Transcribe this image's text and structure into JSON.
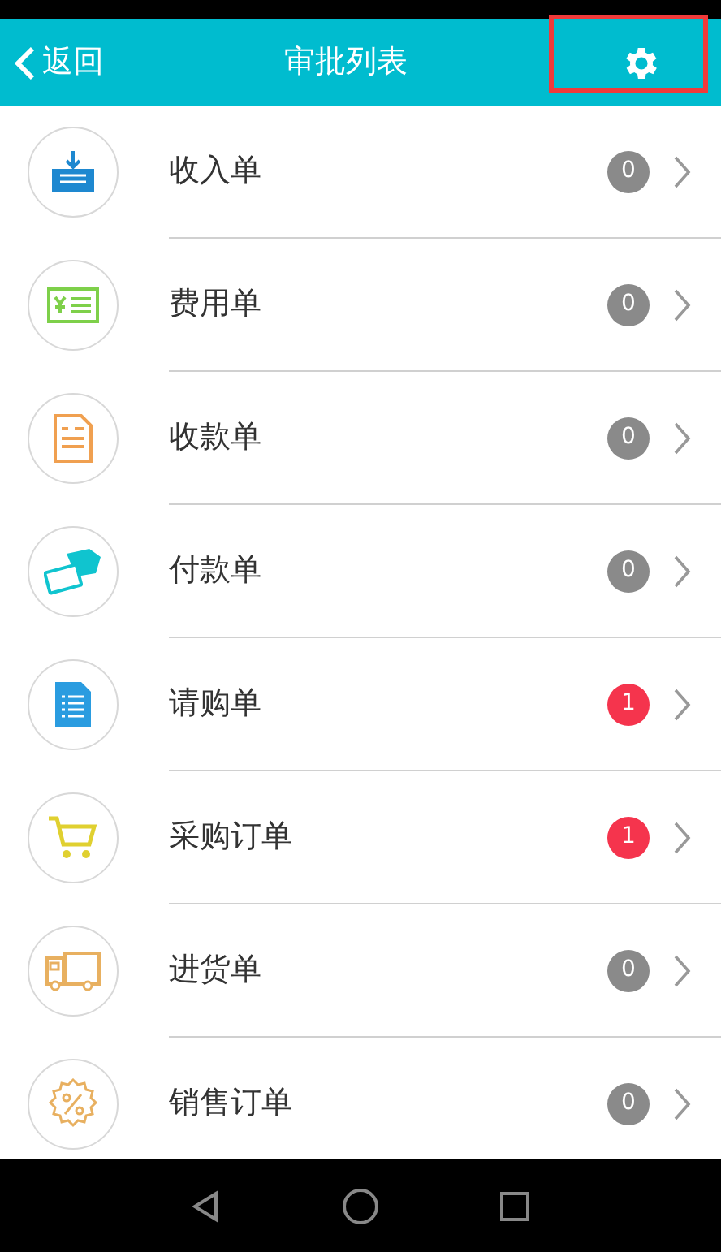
{
  "header": {
    "back": "返回",
    "title": "审批列表",
    "settings": {
      "highlighted": true
    }
  },
  "items": [
    {
      "kind": "inbox",
      "label": "收入单",
      "count": "0",
      "color": "#8a8a8a"
    },
    {
      "kind": "bill",
      "label": "费用单",
      "count": "0",
      "color": "#8a8a8a"
    },
    {
      "kind": "receipt",
      "label": "收款单",
      "count": "0",
      "color": "#8a8a8a"
    },
    {
      "kind": "card",
      "label": "付款单",
      "count": "0",
      "color": "#8a8a8a"
    },
    {
      "kind": "list",
      "label": "请购单",
      "count": "1",
      "color": "#f5344d"
    },
    {
      "kind": "cart",
      "label": "采购订单",
      "count": "1",
      "color": "#f5344d"
    },
    {
      "kind": "truck",
      "label": "进货单",
      "count": "0",
      "color": "#8a8a8a"
    },
    {
      "kind": "discount",
      "label": "销售订单",
      "count": "0",
      "color": "#8a8a8a"
    }
  ]
}
